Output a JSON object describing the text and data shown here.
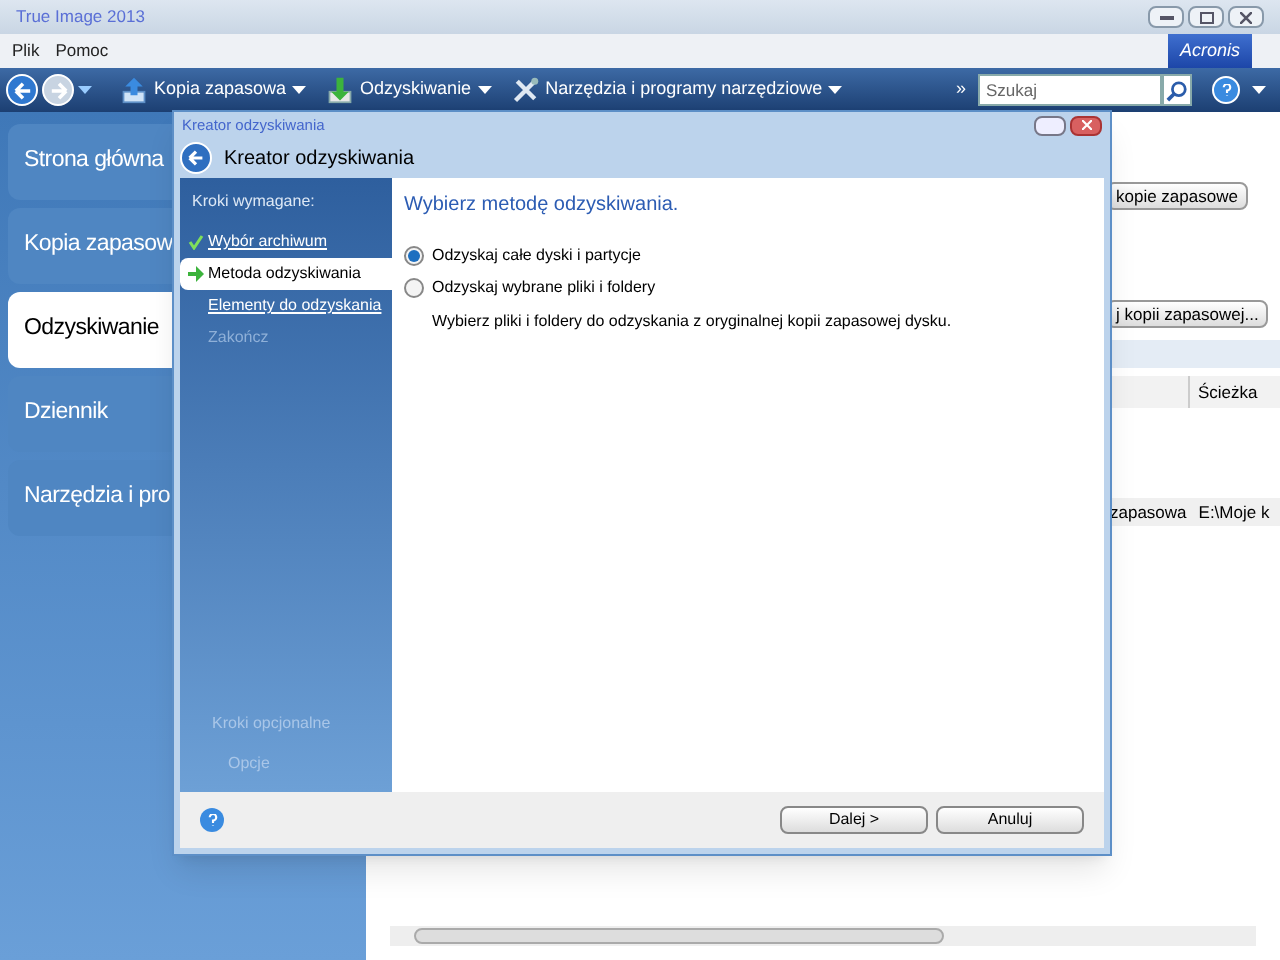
{
  "window": {
    "title": "True Image 2013"
  },
  "menu": [
    "Plik",
    "Pomoc"
  ],
  "brand": {
    "logo": "Acronis"
  },
  "toolbar": {
    "items": [
      {
        "label": "Kopia zapasowa",
        "kind": "backup"
      },
      {
        "label": "Odzyskiwanie",
        "kind": "recover"
      },
      {
        "label": "Narzędzia i programy narzędziowe",
        "kind": "tools"
      }
    ],
    "more": "»",
    "search": {
      "placeholder": "Szukaj"
    }
  },
  "nav": [
    {
      "label": "Strona główna",
      "selected": false
    },
    {
      "label": "Kopia zapasow",
      "selected": false
    },
    {
      "label": "Odzyskiwanie",
      "selected": true
    },
    {
      "label": "Dziennik",
      "selected": false
    },
    {
      "label": "Narzędzia i pro",
      "selected": false
    }
  ],
  "background": {
    "buttons": [
      "kopie zapasowe",
      "j kopii zapasowej..."
    ],
    "column_header": "Ścieżka",
    "row": [
      "zapasowa",
      "E:\\Moje k"
    ]
  },
  "dialog": {
    "title": "Kreator odzyskiwania",
    "header": "Kreator odzyskiwania",
    "steps_heading": "Kroki wymagane:",
    "steps": [
      {
        "label": "Wybór archiwum",
        "kind": "done",
        "selected": false
      },
      {
        "label": "Metoda odzyskiwania",
        "kind": "current",
        "selected": true
      },
      {
        "label": "Elementy do odzyskania",
        "kind": "todo",
        "selected": false
      },
      {
        "label": "Zakończ",
        "kind": "disabled",
        "selected": false
      }
    ],
    "optional_heading": "Kroki opcjonalne",
    "optional_steps": [
      "Opcje"
    ],
    "heading": "Wybierz metodę odzyskiwania.",
    "options": [
      {
        "label": "Odzyskaj całe dyski i partycje",
        "selected": true
      },
      {
        "label": "Odzyskaj wybrane pliki i foldery",
        "selected": false,
        "description": "Wybierz pliki i foldery do odzyskania z oryginalnej kopii zapasowej dysku."
      }
    ],
    "buttons": [
      "Dalej >",
      "Anuluj"
    ]
  }
}
